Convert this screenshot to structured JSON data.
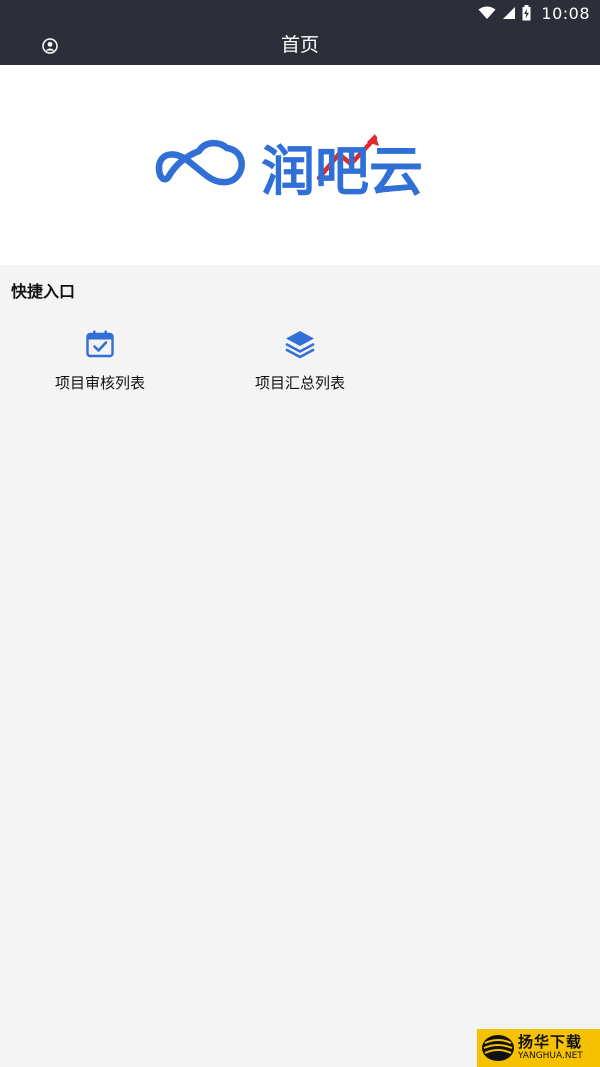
{
  "status_bar": {
    "time": "10:08",
    "icons": [
      "wifi-icon",
      "signal-icon",
      "battery-charging-icon"
    ]
  },
  "app_bar": {
    "title": "首页",
    "left_icon": "user-icon"
  },
  "banner": {
    "logo_text": "润吧云",
    "logo_color": "#2f6fd6",
    "arrow_color": "#e02a2a"
  },
  "quick_entry": {
    "title": "快捷入口",
    "items": [
      {
        "label": "项目审核列表",
        "icon": "calendar-check-icon"
      },
      {
        "label": "项目汇总列表",
        "icon": "layers-icon"
      }
    ],
    "icon_color": "#2f6fd6"
  },
  "watermark": {
    "cn": "扬华下载",
    "en": "YANGHUA.NET",
    "bg_color": "#f6c200"
  }
}
